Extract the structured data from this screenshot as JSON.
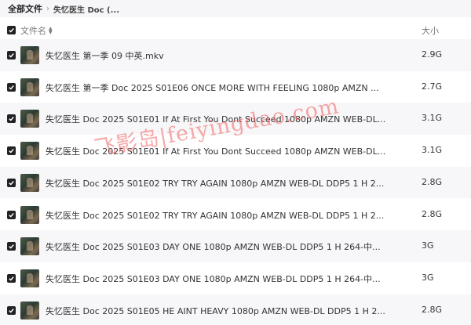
{
  "breadcrumb": {
    "root": "全部文件",
    "separator": "›",
    "current": "失忆医生 Doc (..."
  },
  "header": {
    "name_label": "文件名",
    "size_label": "大小",
    "sort_icon": "sort-arrows-icon"
  },
  "files": [
    {
      "name": "失忆医生 第一季 09 中英.mkv",
      "size": "2.9G"
    },
    {
      "name": "失忆医生 第一季 Doc 2025 S01E06 ONCE MORE WITH FEELING 1080p AMZN ...",
      "size": "2.7G"
    },
    {
      "name": "失忆医生 Doc 2025 S01E01 If At First You Dont Succeed 1080p AMZN WEB-DL...",
      "size": "3.1G"
    },
    {
      "name": "失忆医生 Doc 2025 S01E01 If At First You Dont Succeed 1080p AMZN WEB-DL...",
      "size": "3.1G"
    },
    {
      "name": "失忆医生 Doc 2025 S01E02 TRY TRY AGAIN 1080p AMZN WEB-DL DDP5 1 H 2...",
      "size": "2.8G"
    },
    {
      "name": "失忆医生 Doc 2025 S01E02 TRY TRY AGAIN 1080p AMZN WEB-DL DDP5 1 H 2...",
      "size": "2.8G"
    },
    {
      "name": "失忆医生 Doc 2025 S01E03 DAY ONE 1080p AMZN WEB-DL DDP5 1 H 264-中...",
      "size": "3G"
    },
    {
      "name": "失忆医生 Doc 2025 S01E03 DAY ONE 1080p AMZN WEB-DL DDP5 1 H 264-中...",
      "size": "3G"
    },
    {
      "name": "失忆医生 Doc 2025 S01E05 HE AINT HEAVY 1080p AMZN WEB-DL DDP5 1 H 2...",
      "size": "2.8G"
    }
  ],
  "watermark": "飞影岛|feiyingdao.com",
  "colors": {
    "checkbox": "#222222",
    "watermark": "#f26060",
    "row_alt": "#f7f7f9"
  }
}
